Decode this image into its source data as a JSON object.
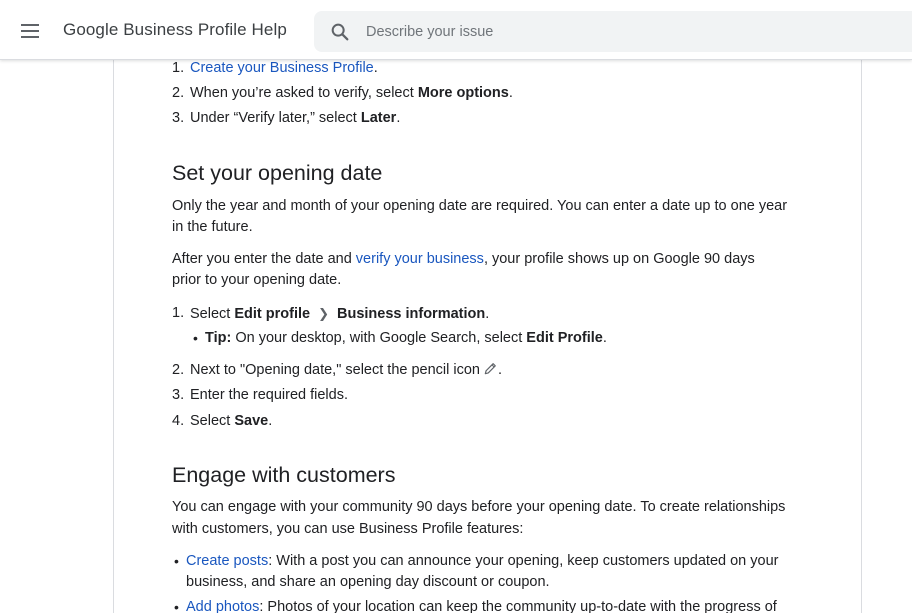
{
  "header": {
    "title": "Google Business Profile Help",
    "menu_icon": "menu-icon",
    "search": {
      "placeholder": "Describe your issue",
      "value": "",
      "icon": "search-icon"
    }
  },
  "article": {
    "intro_steps": [
      {
        "num": "1.",
        "link": "Create your Business Profile",
        "after": "."
      },
      {
        "num": "2.",
        "before": "When you’re asked to verify, select ",
        "bold": "More options",
        "after": "."
      },
      {
        "num": "3.",
        "before": "Under “Verify later,” select ",
        "bold": "Later",
        "after": "."
      }
    ],
    "opening_date": {
      "heading": "Set your opening date",
      "para1_line1": "Only the year and month of your opening date are required. You can enter a date up to one year",
      "para1_line2": "in the future.",
      "para2_before": "After you enter the date and ",
      "para2_link": "verify your business",
      "para2_after": ", your profile shows up on Google 90 days",
      "para2_line2": "prior to your opening date.",
      "steps": {
        "s1_num": "1.",
        "s1_before": "Select ",
        "s1_bold1": "Edit profile",
        "s1_bold2": "Business information",
        "s1_after": ".",
        "tip_label": "Tip:",
        "tip_text": " On your desktop, with Google Search, select ",
        "tip_bold": "Edit Profile",
        "tip_after": ".",
        "s2_num": "2.",
        "s2_text": "Next to \"Opening date,\" select the pencil icon",
        "s2_after": ".",
        "s3_num": "3.",
        "s3_text": "Enter the required fields.",
        "s4_num": "4.",
        "s4_before": "Select ",
        "s4_bold": "Save",
        "s4_after": "."
      }
    },
    "engage": {
      "heading": "Engage with customers",
      "para_line1": "You can engage with your community 90 days before your opening date. To create relationships",
      "para_line2": "with customers, you can use Business Profile features:",
      "b1_link": "Create posts",
      "b1_text": ": With a post you can announce your opening, keep customers updated on your",
      "b1_line2": "business, and share an opening day discount or coupon.",
      "b2_link": "Add photos",
      "b2_text": ": Photos of your location can keep the community up-to-date with the progress of"
    }
  },
  "colors": {
    "link": "#1a57bf",
    "text": "#202124",
    "search_bg": "#f1f3f4",
    "border": "#dadce0"
  }
}
